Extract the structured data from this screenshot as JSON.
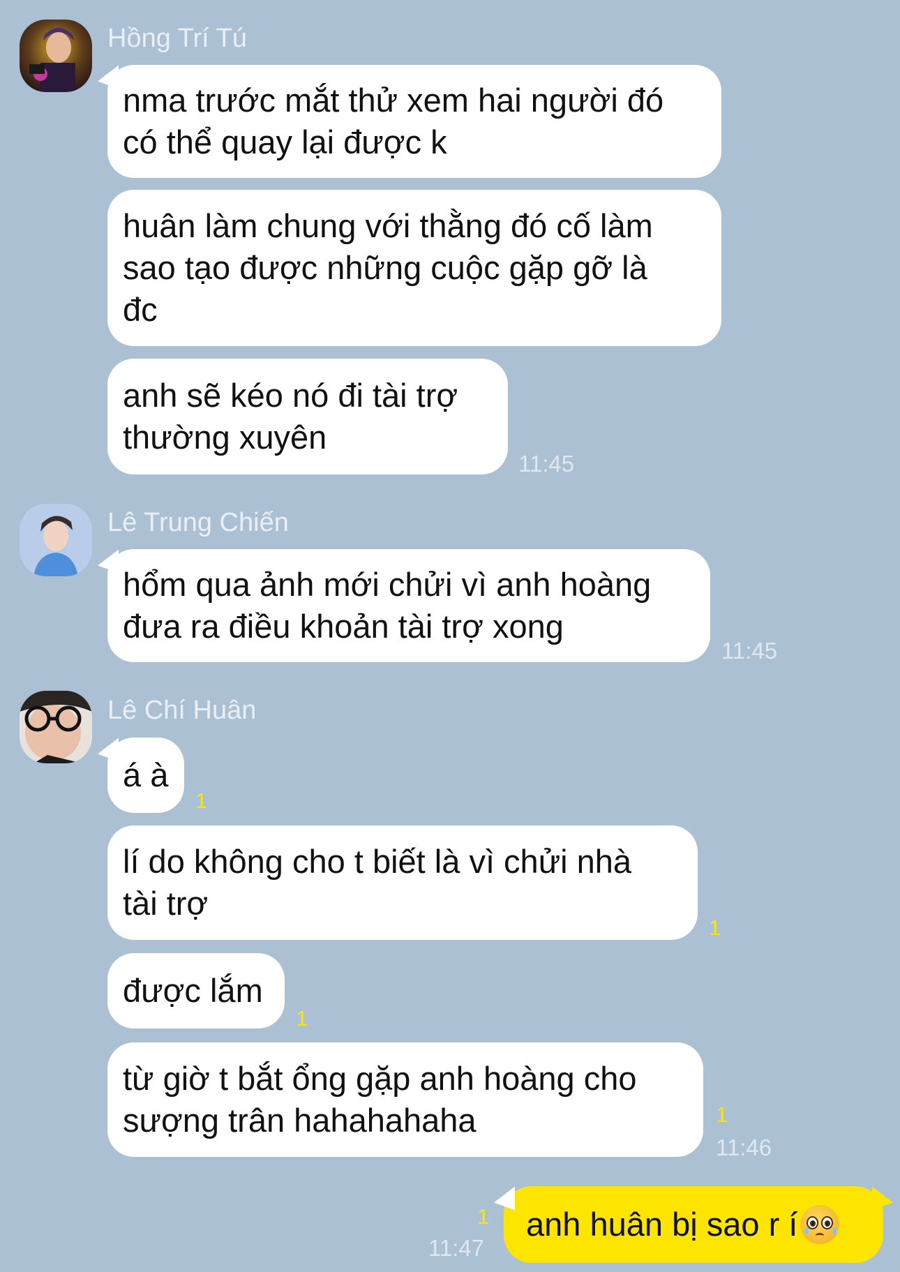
{
  "messages": {
    "m1": {
      "sender": "Hồng Trí Tú",
      "bubbles": [
        "nma trước mắt thử xem hai người đó\ncó thể quay lại được k",
        "huân làm chung với thằng đó cố làm\nsao tạo được những cuộc gặp gỡ là\nđc",
        "anh sẽ kéo nó đi tài trợ\nthường xuyên"
      ],
      "time": "11:45"
    },
    "m2": {
      "sender": "Lê Trung Chiến",
      "bubbles": [
        "hổm qua ảnh mới chửi vì anh hoàng\nđưa ra điều khoản tài trợ xong"
      ],
      "time": "11:45"
    },
    "m3": {
      "sender": "Lê Chí Huân",
      "bubbles": [
        "á à",
        "lí do không cho t biết là vì chửi nhà\ntài trợ",
        "được lắm",
        "từ giờ t bắt ổng gặp anh hoàng cho\nsượng trân hahahahaha"
      ],
      "unread": [
        "1",
        "1",
        "1",
        "1"
      ],
      "time": "11:46"
    },
    "mine": {
      "text": "anh huân bị sao r í",
      "emoji": "pleading-face-emoji",
      "unread": "1",
      "time": "11:47"
    }
  },
  "colors": {
    "background": "#abc1d3",
    "incoming_bubble": "#ffffff",
    "outgoing_bubble": "#fee500",
    "unread_count": "#fee500",
    "sender_name": "#e9eff5",
    "timestamp": "#dfe7ef"
  },
  "avatars": {
    "a1": "avatar-hong-tri-tu",
    "a2": "avatar-le-trung-chien",
    "a3": "avatar-le-chi-huan"
  }
}
